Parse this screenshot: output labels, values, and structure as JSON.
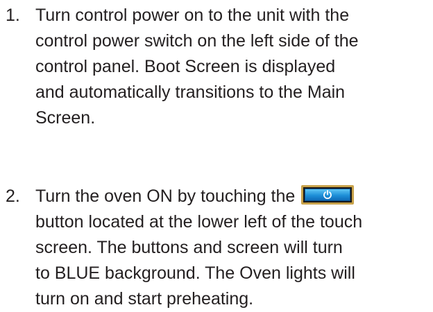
{
  "steps": [
    {
      "number": "1.",
      "lines": [
        "Turn control power on to the unit with the",
        "control power switch on the left side of the",
        "control panel. Boot Screen is displayed",
        "and automatically transitions to the Main",
        "Screen."
      ]
    },
    {
      "number": "2.",
      "first_line_before_button": "Turn the oven ON by touching the",
      "button_icon": "power-icon",
      "lines": [
        "button located at the lower left of the touch",
        "screen. The buttons and screen will turn",
        "to BLUE background. The Oven lights will",
        "turn on and start preheating."
      ]
    }
  ],
  "colors": {
    "text": "#231f20",
    "button_blue": "#1e8fd8",
    "button_border": "#c8a24a"
  }
}
